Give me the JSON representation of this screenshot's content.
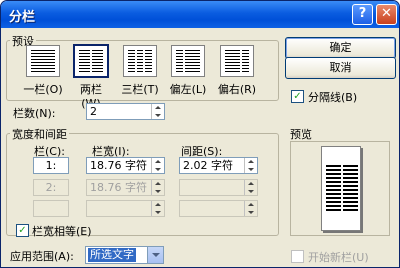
{
  "window": {
    "title": "分栏",
    "help": "?",
    "close": "✕"
  },
  "presets": {
    "group_label": "预设",
    "items": [
      {
        "label": "一栏(O)",
        "cols": 1
      },
      {
        "label": "两栏(W)",
        "cols": 2
      },
      {
        "label": "三栏(T)",
        "cols": 3
      },
      {
        "label": "偏左(L)",
        "cols": 2
      },
      {
        "label": "偏右(R)",
        "cols": 2
      }
    ]
  },
  "buttons": {
    "ok": "确定",
    "cancel": "取消"
  },
  "separator": {
    "label": "分隔线(B)",
    "checked": true
  },
  "columns_count": {
    "label": "栏数(N):",
    "value": "2"
  },
  "width_spacing": {
    "group_label": "宽度和间距",
    "col_header": "栏(C):",
    "width_header": "栏宽(I):",
    "spacing_header": "间距(S):",
    "rows": [
      {
        "num": "1:",
        "width": "18.76 字符",
        "spacing": "2.02 字符"
      },
      {
        "num": "2:",
        "width": "18.76 字符",
        "spacing": ""
      },
      {
        "num": "",
        "width": "",
        "spacing": ""
      }
    ]
  },
  "equal_width": {
    "label": "栏宽相等(E)",
    "checked": true
  },
  "preview": {
    "label": "预览"
  },
  "apply_to": {
    "label": "应用范围(A):",
    "value": "所选文字"
  },
  "new_column": {
    "label": "开始新栏(U)",
    "checked": false
  }
}
